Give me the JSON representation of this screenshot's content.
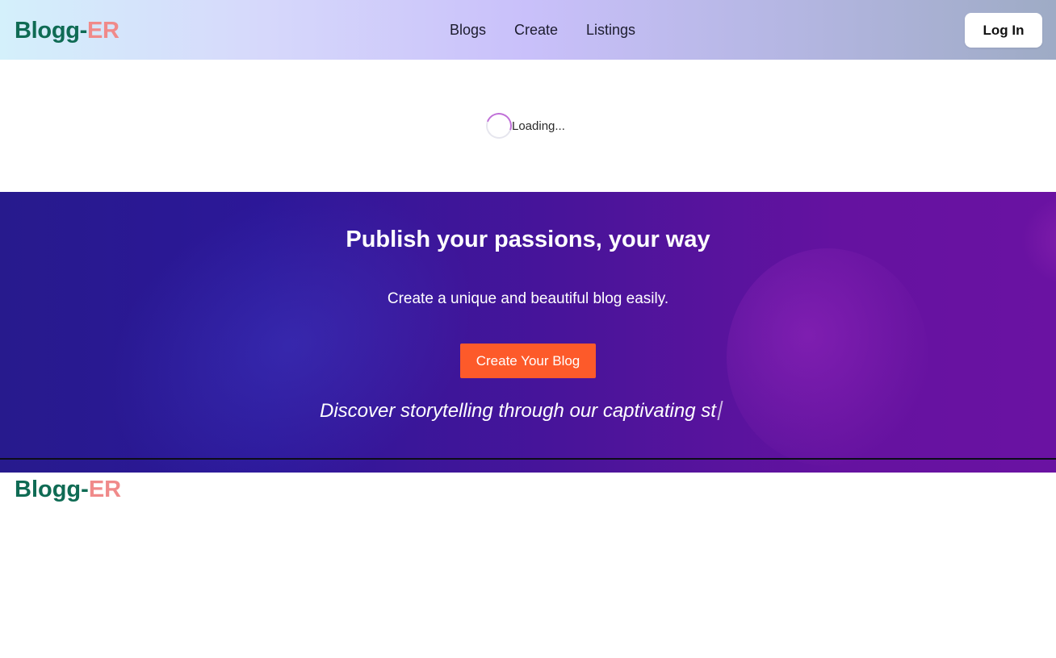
{
  "navbar": {
    "logo_main": "Blogg-",
    "logo_accent": "ER",
    "links": [
      "Blogs",
      "Create",
      "Listings"
    ],
    "login_label": "Log In"
  },
  "loading": {
    "text": "Loading..."
  },
  "hero": {
    "title": "Publish your passions, your way",
    "subtitle": "Create a unique and beautiful blog easily.",
    "cta_label": "Create Your Blog",
    "typing_text": "Discover storytelling through our captivating st"
  },
  "footer": {
    "logo_main": "Blogg-",
    "logo_accent": "ER"
  },
  "colors": {
    "logo_green": "#0f6b54",
    "logo_accent_pink": "#f08a8a",
    "cta_orange": "#fd5a2a",
    "hero_start": "#271a8d",
    "hero_end": "#6a12a2"
  }
}
